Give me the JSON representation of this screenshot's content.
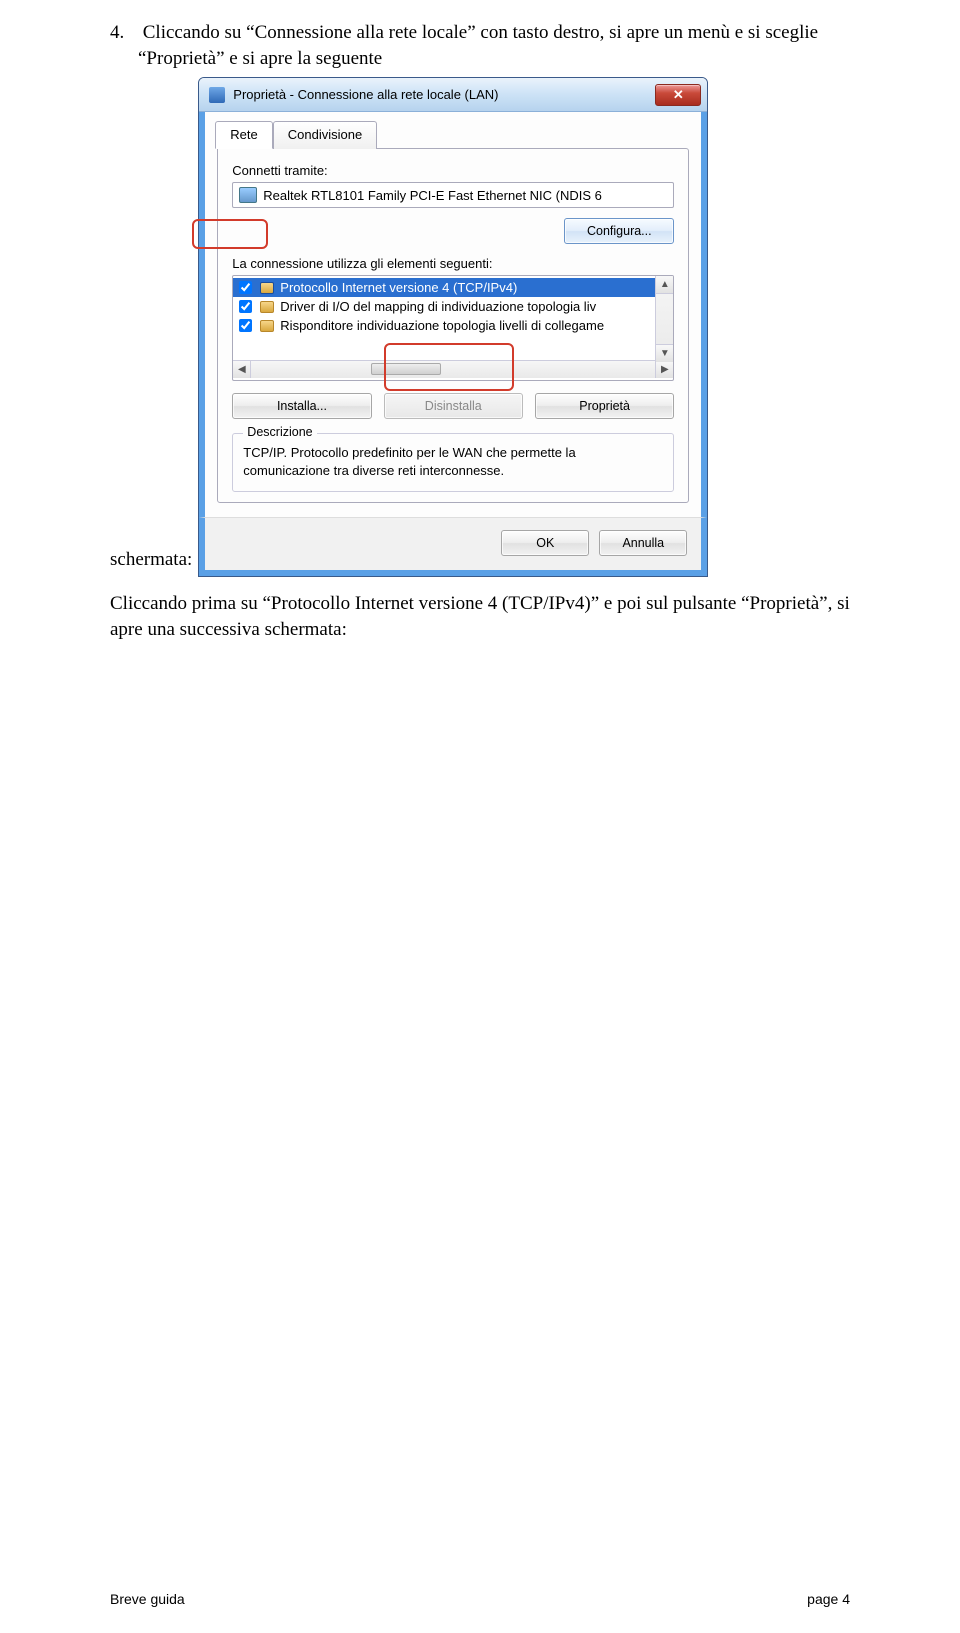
{
  "step": {
    "number": "4.",
    "text_line1": "Cliccando su “Connessione alla rete locale” con tasto destro,  si apre un menù  e si sceglie",
    "text_line2": "“Proprietà” e si apre la seguente"
  },
  "schermata_label": "schermata:",
  "dialog": {
    "title": "Proprietà - Connessione alla rete locale (LAN)",
    "close_glyph": "✕",
    "tabs": {
      "rete": "Rete",
      "condivisione": "Condivisione"
    },
    "connect_via_label": "Connetti tramite:",
    "adapter": "Realtek RTL8101 Family PCI-E Fast Ethernet NIC (NDIS 6",
    "configure_btn": "Configura...",
    "elements_label": "La connessione utilizza gli elementi seguenti:",
    "items": [
      {
        "checked": true,
        "label": "Protocollo Internet versione 4 (TCP/IPv4)",
        "selected": true
      },
      {
        "checked": true,
        "label": "Driver di I/O del mapping di individuazione topologia liv"
      },
      {
        "checked": true,
        "label": "Risponditore individuazione topologia livelli di collegame"
      }
    ],
    "install_btn": "Installa...",
    "uninstall_btn": "Disinstalla",
    "properties_btn": "Proprietà",
    "desc_legend": "Descrizione",
    "desc_text": "TCP/IP. Protocollo predefinito per le WAN che permette la comunicazione tra diverse reti interconnesse.",
    "ok_btn": "OK",
    "cancel_btn": "Annulla"
  },
  "para2": {
    "l1": "Cliccando prima su “Protocollo Internet  versione 4 (TCP/IPv4)” e poi sul pulsante “Proprietà”, si",
    "l2": "apre una successiva  schermata:"
  },
  "footer": {
    "left": "Breve guida",
    "right": "page 4"
  }
}
